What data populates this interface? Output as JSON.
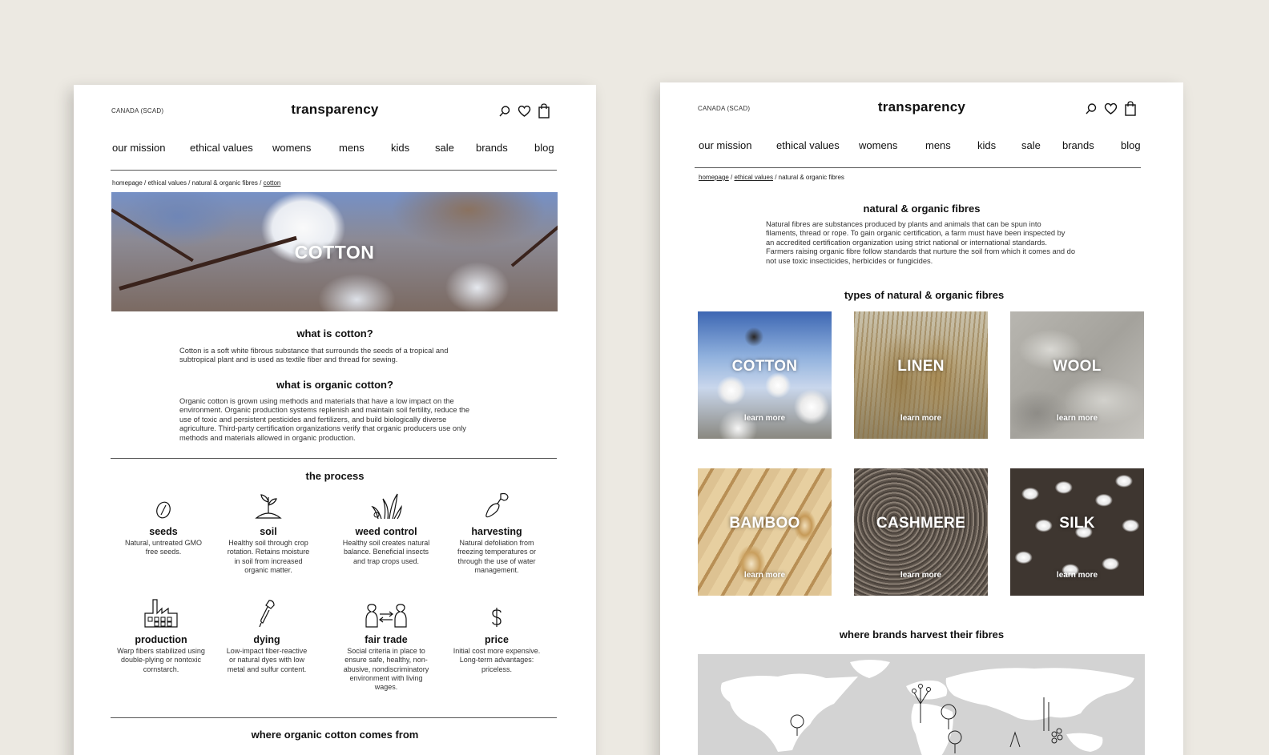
{
  "left_page": {
    "region": "CANADA (SCAD)",
    "brand": "transparency",
    "nav": [
      "our mission",
      "ethical values",
      "womens",
      "mens",
      "kids",
      "sale",
      "brands",
      "blog"
    ],
    "breadcrumb": {
      "path": "homepage / ethical values / natural & organic fibres / ",
      "current": "cotton"
    },
    "hero_title": "COTTON",
    "what_is_heading": "what is cotton?",
    "what_is_text": "Cotton is a soft white fibrous substance that surrounds the seeds of a tropical and subtropical plant and is used as textile fiber and thread for sewing.",
    "organic_heading": "what is organic cotton?",
    "organic_text": "Organic cotton is grown using methods and materials that have a low impact on the environment. Organic production systems replenish and maintain soil fertility, reduce the use of toxic and persistent pesticides and fertilizers, and build biologically diverse agriculture. Third-party certification organizations verify that organic producers use only methods and materials allowed in organic production.",
    "process_heading": "the process",
    "process": [
      {
        "icon": "seed-icon",
        "title": "seeds",
        "text": "Natural, untreated GMO free seeds."
      },
      {
        "icon": "sprout-icon",
        "title": "soil",
        "text": "Healthy soil through crop rotation. Retains moisture in soil from increased organic matter."
      },
      {
        "icon": "plants-icon",
        "title": "weed control",
        "text": "Healthy soil creates natural balance. Beneficial insects and trap crops used."
      },
      {
        "icon": "trowel-icon",
        "title": "harvesting",
        "text": "Natural defoliation from freezing temperatures or through the use of water management."
      },
      {
        "icon": "factory-icon",
        "title": "production",
        "text": "Warp fibers stabilized using double-plying or nontoxic cornstarch."
      },
      {
        "icon": "dropper-icon",
        "title": "dying",
        "text": "Low-impact fiber-reactive or natural dyes with low metal and sulfur content."
      },
      {
        "icon": "exchange-icon",
        "title": "fair trade",
        "text": "Social criteria in place to ensure safe, healthy, non-abusive, nondiscriminatory environment with living wages."
      },
      {
        "icon": "dollar-icon",
        "title": "price",
        "text": "Initial cost more expensive. Long-term advantages: priceless."
      }
    ],
    "origin_heading": "where organic cotton comes from"
  },
  "right_page": {
    "region": "CANADA (SCAD)",
    "brand": "transparency",
    "nav": [
      "our mission",
      "ethical values",
      "womens",
      "mens",
      "kids",
      "sale",
      "brands",
      "blog"
    ],
    "breadcrumb": {
      "link1": "homepage",
      "sep1": " / ",
      "link2": "ethical values",
      "rest": " / natural & organic fibres"
    },
    "heading": "natural & organic fibres",
    "intro": "Natural fibres are substances produced by plants and animals that can be spun into filaments, thread or rope. To gain organic certification, a farm must have been inspected by an accredited certification organization using strict national or international standards. Farmers raising organic fibre follow standards that nurture the soil from which it comes and do not use toxic insecticides, herbicides or fungicides.",
    "types_heading": "types of natural & organic fibres",
    "fibres": [
      {
        "name": "COTTON",
        "link": "learn more"
      },
      {
        "name": "LINEN",
        "link": "learn more"
      },
      {
        "name": "WOOL",
        "link": "learn more"
      },
      {
        "name": "BAMBOO",
        "link": "learn more"
      },
      {
        "name": "CASHMERE",
        "link": "learn more"
      },
      {
        "name": "SILK",
        "link": "learn more"
      }
    ],
    "map_heading": "where brands harvest their fibres"
  }
}
